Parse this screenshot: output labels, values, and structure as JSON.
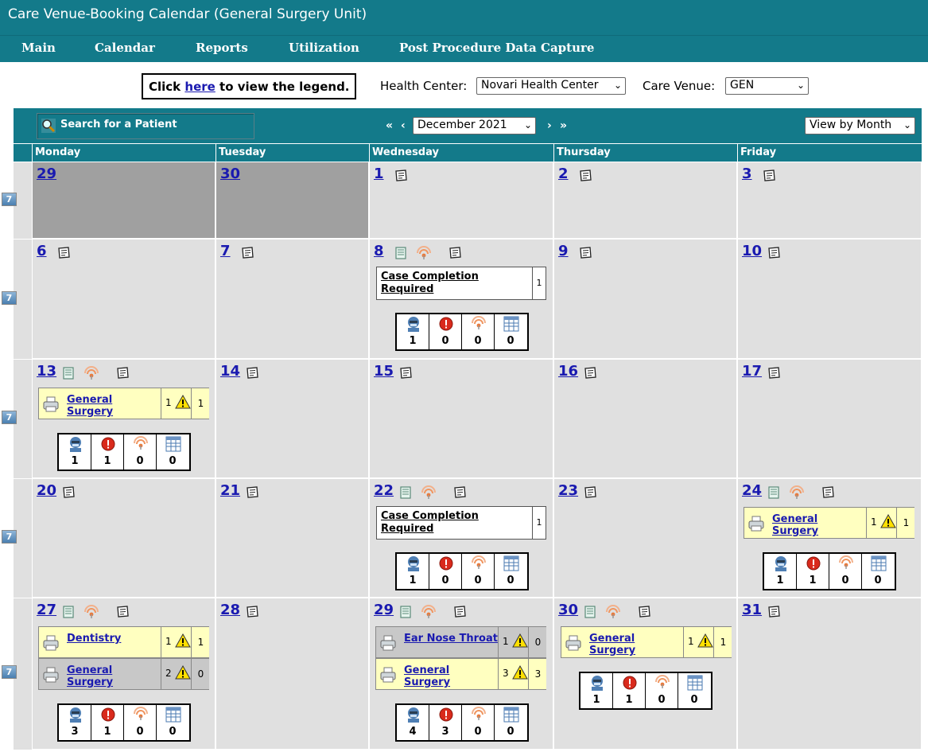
{
  "app": {
    "title": "Care Venue-Booking Calendar (General Surgery Unit)"
  },
  "nav": [
    "Main",
    "Calendar",
    "Reports",
    "Utilization",
    "Post Procedure Data Capture"
  ],
  "legend": {
    "prefix": "Click ",
    "link": "here",
    "suffix": " to view the legend."
  },
  "filters": {
    "health_center_label": "Health Center:",
    "health_center": "Novari Health Center",
    "care_venue_label": "Care Venue:",
    "care_venue": "GEN"
  },
  "calendar": {
    "search_label": "Search for a Patient",
    "month": "December 2021",
    "view": "View by Month",
    "nav_first": "«",
    "nav_prev": "‹",
    "nav_next": "›",
    "nav_last": "»",
    "days": [
      "Monday",
      "Tuesday",
      "Wednesday",
      "Thursday",
      "Friday"
    ],
    "week_icon": "7",
    "case_completion": "Case Completion Required",
    "cells": {
      "c0_0": {
        "day": "29"
      },
      "c0_1": {
        "day": "30"
      },
      "c0_2": {
        "day": "1"
      },
      "c0_3": {
        "day": "2"
      },
      "c0_4": {
        "day": "3"
      },
      "c1_0": {
        "day": "6"
      },
      "c1_1": {
        "day": "7"
      },
      "c1_2": {
        "day": "8",
        "case_count": "1",
        "stats": [
          "1",
          "0",
          "0",
          "0"
        ]
      },
      "c1_3": {
        "day": "9"
      },
      "c1_4": {
        "day": "10"
      },
      "c2_0": {
        "day": "13",
        "svc": [
          {
            "name": "General Surgery",
            "mid": "1",
            "end": "1"
          }
        ],
        "stats": [
          "1",
          "1",
          "0",
          "0"
        ]
      },
      "c2_1": {
        "day": "14"
      },
      "c2_2": {
        "day": "15"
      },
      "c2_3": {
        "day": "16"
      },
      "c2_4": {
        "day": "17"
      },
      "c3_0": {
        "day": "20"
      },
      "c3_1": {
        "day": "21"
      },
      "c3_2": {
        "day": "22",
        "case_count": "1",
        "stats": [
          "1",
          "0",
          "0",
          "0"
        ]
      },
      "c3_3": {
        "day": "23"
      },
      "c3_4": {
        "day": "24",
        "svc": [
          {
            "name": "General Surgery",
            "mid": "1",
            "end": "1"
          }
        ],
        "stats": [
          "1",
          "1",
          "0",
          "0"
        ]
      },
      "c4_0": {
        "day": "27",
        "svc": [
          {
            "name": "Dentistry",
            "mid": "1",
            "end": "1"
          },
          {
            "name": "General Surgery",
            "mid": "2",
            "end": "0"
          }
        ],
        "stats": [
          "3",
          "1",
          "0",
          "0"
        ]
      },
      "c4_1": {
        "day": "28"
      },
      "c4_2": {
        "day": "29",
        "svc": [
          {
            "name": "Ear Nose Throat",
            "mid": "1",
            "end": "0"
          },
          {
            "name": "General Surgery",
            "mid": "3",
            "end": "3"
          }
        ],
        "stats": [
          "4",
          "3",
          "0",
          "0"
        ]
      },
      "c4_3": {
        "day": "30",
        "svc": [
          {
            "name": "General Surgery",
            "mid": "1",
            "end": "1"
          }
        ],
        "stats": [
          "1",
          "1",
          "0",
          "0"
        ]
      },
      "c4_4": {
        "day": "31"
      }
    }
  },
  "colors": {
    "header": "#137a8a",
    "cell": "#e0e0e0",
    "past_cell": "#a0a0a0",
    "service_yellow": "#ffffc0",
    "service_grey": "#c8c8c8",
    "link": "#1a1ab0"
  },
  "icons": [
    "search-icon",
    "note-icon",
    "document-icon",
    "signal-icon",
    "printer-icon",
    "warning-icon",
    "surgeon-icon",
    "alert-icon",
    "grid-icon",
    "week-icon"
  ]
}
